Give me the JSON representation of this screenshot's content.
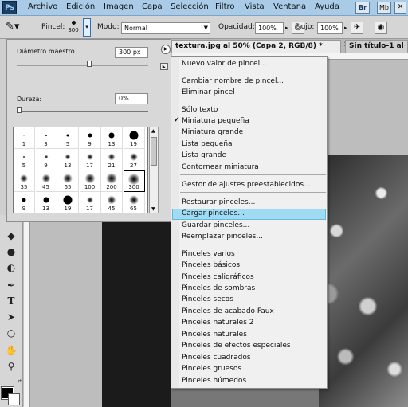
{
  "menubar": {
    "logo": "Ps",
    "items": [
      "Archivo",
      "Edición",
      "Imagen",
      "Capa",
      "Selección",
      "Filtro",
      "Vista",
      "Ventana",
      "Ayuda"
    ],
    "bridge_label": "Br",
    "minibridge_label": "Mb"
  },
  "options": {
    "pincel_label": "Pincel:",
    "brush_size": "300",
    "modo_label": "Modo:",
    "modo_value": "Normal",
    "opacidad_label": "Opacidad:",
    "opacidad_value": "100%",
    "flujo_label": "Flujo:",
    "flujo_value": "100%"
  },
  "tabs": [
    {
      "label": "textura.jpg al 50% (Capa 2, RGB/8) *"
    },
    {
      "label": "Sin título-1 al"
    }
  ],
  "brush_panel": {
    "diameter_label": "Diámetro maestro",
    "diameter_value": "300 px",
    "diameter_level": 0.55,
    "hardness_label": "Dureza:",
    "hardness_value": "0%",
    "hardness_level": 0.0,
    "presets": [
      {
        "size": "1",
        "soft": false
      },
      {
        "size": "3",
        "soft": false
      },
      {
        "size": "5",
        "soft": false
      },
      {
        "size": "9",
        "soft": false
      },
      {
        "size": "13",
        "soft": false
      },
      {
        "size": "19",
        "soft": false
      },
      {
        "size": "5",
        "soft": true
      },
      {
        "size": "9",
        "soft": true
      },
      {
        "size": "13",
        "soft": true
      },
      {
        "size": "17",
        "soft": true
      },
      {
        "size": "21",
        "soft": true
      },
      {
        "size": "27",
        "soft": true
      },
      {
        "size": "35",
        "soft": true
      },
      {
        "size": "45",
        "soft": true
      },
      {
        "size": "65",
        "soft": true
      },
      {
        "size": "100",
        "soft": true
      },
      {
        "size": "200",
        "soft": true
      },
      {
        "size": "300",
        "soft": true,
        "selected": true
      },
      {
        "size": "9",
        "soft": false
      },
      {
        "size": "13",
        "soft": false
      },
      {
        "size": "19",
        "soft": false
      },
      {
        "size": "17",
        "soft": true
      },
      {
        "size": "45",
        "soft": true
      },
      {
        "size": "65",
        "soft": true
      }
    ]
  },
  "context_menu": {
    "items": [
      {
        "label": "Nuevo valor de pincel..."
      },
      {
        "label": "Cambiar nombre de pincel..."
      },
      {
        "label": "Eliminar pincel"
      },
      {
        "label": "Sólo texto"
      },
      {
        "label": "Miniatura pequeña",
        "checked": true
      },
      {
        "label": "Miniatura grande"
      },
      {
        "label": "Lista pequeña"
      },
      {
        "label": "Lista grande"
      },
      {
        "label": "Contornear miniatura"
      },
      {
        "label": "Gestor de ajustes preestablecidos..."
      },
      {
        "label": "Restaurar pinceles..."
      },
      {
        "label": "Cargar pinceles...",
        "highlighted": true
      },
      {
        "label": "Guardar pinceles..."
      },
      {
        "label": "Reemplazar pinceles..."
      },
      {
        "label": "Pinceles varios"
      },
      {
        "label": "Pinceles básicos"
      },
      {
        "label": "Pinceles caligráficos"
      },
      {
        "label": "Pinceles de sombras"
      },
      {
        "label": "Pinceles secos"
      },
      {
        "label": "Pinceles de acabado Faux"
      },
      {
        "label": "Pinceles naturales 2"
      },
      {
        "label": "Pinceles naturales"
      },
      {
        "label": "Pinceles de efectos especiales"
      },
      {
        "label": "Pinceles cuadrados"
      },
      {
        "label": "Pinceles gruesos"
      },
      {
        "label": "Pinceles húmedos"
      }
    ]
  },
  "colors": {
    "highlight": "#9fdcf4",
    "menubar": "#a9cbe7"
  }
}
